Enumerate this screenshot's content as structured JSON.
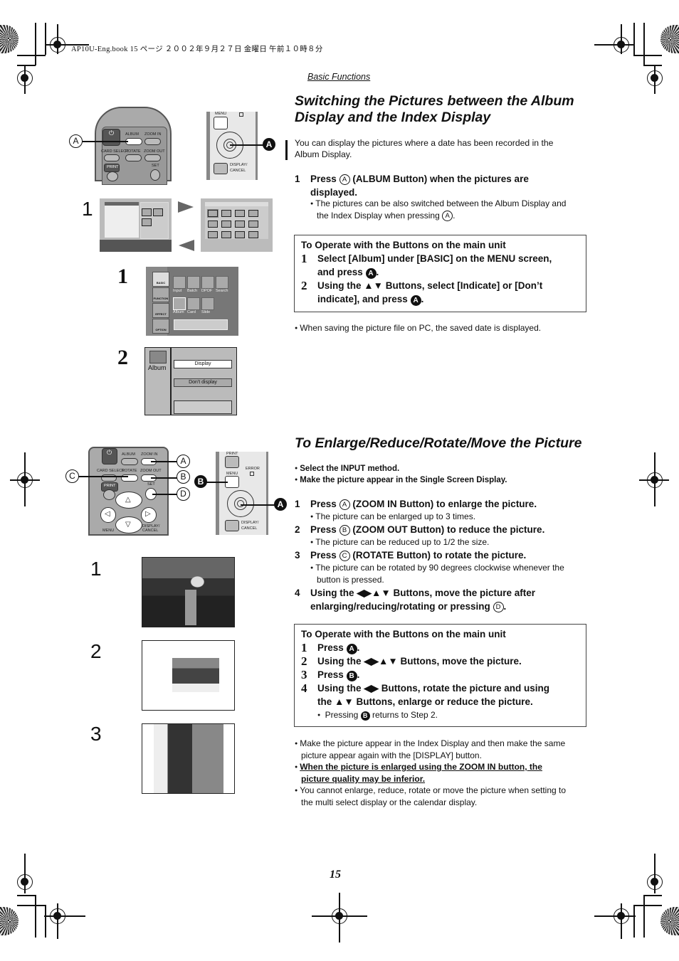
{
  "print_header": {
    "file_info": "AP10U-Eng.book   15 ページ   ２００２年９月２７日   金曜日   午前１０時８分"
  },
  "section_tag": "Basic Functions",
  "section1": {
    "title_line1": "Switching the Pictures between the Album",
    "title_line2": "Display and the Index Display",
    "intro_line1": "You can display the pictures where a date has been recorded in the",
    "intro_line2": "Album Display.",
    "step1": {
      "num": "1",
      "pre": "Press",
      "circle": "A",
      "post_line1": "(ALBUM Button) when the pictures are",
      "post_line2": "displayed.",
      "note_line1": "The pictures can be also switched between the Album Display and",
      "note_line2_pre": "the Index Display when pressing",
      "note_circle": "A",
      "note_end": "."
    },
    "main_unit_box": {
      "heading": "To Operate with the Buttons on the main unit",
      "steps": [
        {
          "num": "1",
          "line1": "Select [Album] under [BASIC] on the MENU screen,",
          "line2_pre": "and press",
          "badge": "A",
          "line2_end": "."
        },
        {
          "num": "2",
          "line1": "Using the ▲▼ Buttons, select [Indicate] or [Don’t",
          "line2_pre": "indicate], and press",
          "badge": "A",
          "line2_end": "."
        }
      ]
    },
    "note_after": "When saving the picture file on PC, the saved date is displayed.",
    "figure": {
      "remote_labels": {
        "power": "⏻",
        "album": "ALBUM",
        "zoom_in": "ZOOM IN",
        "card_select": "CARD SELECT",
        "rotate": "ROTATE",
        "zoom_out": "ZOOM OUT",
        "print": "PRINT",
        "set": "SET"
      },
      "callout_remote": "A",
      "panel_labels": {
        "menu": "MENU",
        "display_cancel_1": "DISPLAY/",
        "display_cancel_2": "CANCEL"
      },
      "callout_panel": "A",
      "step_label_1": "1",
      "menu_step_1": "1",
      "menu_step_2": "2",
      "menu_categories": [
        "BASIC",
        "FUNCTION",
        "EFFECT",
        "OPTION"
      ],
      "menu_icons_row1": [
        "Input",
        "Batch",
        "DPOF",
        "Search"
      ],
      "menu_icons_row2": [
        "Album",
        "Card",
        "Slide"
      ],
      "album_screen": {
        "icon_label": "Album",
        "option_selected": "Display",
        "option_other": "Don't display"
      }
    }
  },
  "section2": {
    "title": "To Enlarge/Reduce/Rotate/Move the Picture",
    "prereqs": [
      "Select the INPUT method.",
      "Make the picture appear in the Single Screen Display."
    ],
    "steps": [
      {
        "num": "1",
        "pre": "Press",
        "circle": "A",
        "post": "(ZOOM IN Button) to enlarge the picture.",
        "note": "The picture can be enlarged up to 3 times."
      },
      {
        "num": "2",
        "pre": "Press",
        "circle": "B",
        "post": "(ZOOM OUT Button) to reduce the picture.",
        "note": "The picture can be reduced up to 1/2 the size."
      },
      {
        "num": "3",
        "pre": "Press",
        "circle": "C",
        "post": "(ROTATE Button) to rotate the picture.",
        "note_line1": "The picture can be rotated by 90 degrees clockwise whenever the",
        "note_line2": "button is pressed."
      },
      {
        "num": "4",
        "line1": "Using the ◀▶▲▼ Buttons, move the picture after",
        "line2_pre": "enlarging/reducing/rotating or pressing",
        "circle": "D",
        "line2_end": "."
      }
    ],
    "main_unit_box": {
      "heading": "To Operate with the Buttons on the main unit",
      "steps": [
        {
          "num": "1",
          "pre": "Press",
          "badge": "A",
          "end": "."
        },
        {
          "num": "2",
          "text": "Using the ◀▶▲▼ Buttons, move the picture."
        },
        {
          "num": "3",
          "pre": "Press",
          "badge": "B",
          "end": "."
        },
        {
          "num": "4",
          "line1": "Using the ◀▶ Buttons, rotate the picture and using",
          "line2": "the ▲▼ Buttons, enlarge or reduce the picture."
        }
      ],
      "note_pre": "Pressing",
      "note_badge": "B",
      "note_post": "returns to Step 2."
    },
    "notes": [
      {
        "line1": "Make the picture appear in the Index Display and then make the same",
        "line2": "picture appear again with the [DISPLAY] button."
      },
      {
        "line1": "When the picture is enlarged using the ZOOM IN button, the",
        "line2": "picture quality may be inferior.",
        "emphasis": true
      },
      {
        "line1": "You cannot enlarge, reduce, rotate or move the picture when setting to",
        "line2": "the multi select display or the calendar display."
      }
    ],
    "figure": {
      "remote_labels": {
        "power": "⏻",
        "album": "ALBUM",
        "zoom_in": "ZOOM IN",
        "card_select": "CARD SELECT",
        "rotate": "ROTATE",
        "zoom_out": "ZOOM OUT",
        "print": "PRINT",
        "set": "SET",
        "menu": "MENU",
        "display_cancel": "DISPLAY/ CANCEL",
        "up": "△",
        "down": "▽",
        "left": "◁",
        "right": "▷"
      },
      "callouts_remote": [
        "A",
        "B",
        "C",
        "D"
      ],
      "panel_labels": {
        "print": "PRINT",
        "error": "ERROR",
        "menu": "MENU",
        "display_cancel_1": "DISPLAY/",
        "display_cancel_2": "CANCEL"
      },
      "callouts_panel": [
        "B",
        "A"
      ],
      "photo_steps": [
        "1",
        "2",
        "3"
      ]
    }
  },
  "page_number": "15"
}
